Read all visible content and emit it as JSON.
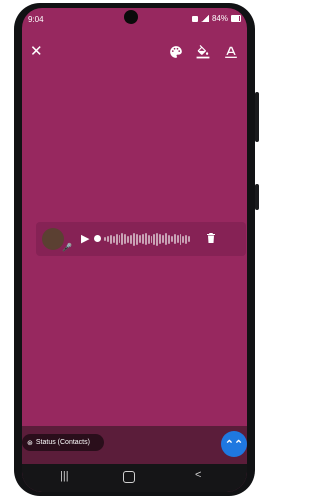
{
  "statusbar": {
    "time": "9:04",
    "battery": "84%"
  },
  "toolbar": {
    "close_icon": "close-icon",
    "palette_icon": "palette-icon",
    "bucket_icon": "paint-bucket-icon",
    "text_icon": "text-icon"
  },
  "voice_note": {
    "play_glyph": "▶",
    "mic_glyph": "🎤"
  },
  "footer": {
    "status_label": "Status (Contacts)",
    "send_glyph": "⌃⌃"
  },
  "navbar": {
    "recents": "|||",
    "back": "<"
  },
  "colors": {
    "background": "#97285f",
    "fab": "#1f78e0"
  }
}
